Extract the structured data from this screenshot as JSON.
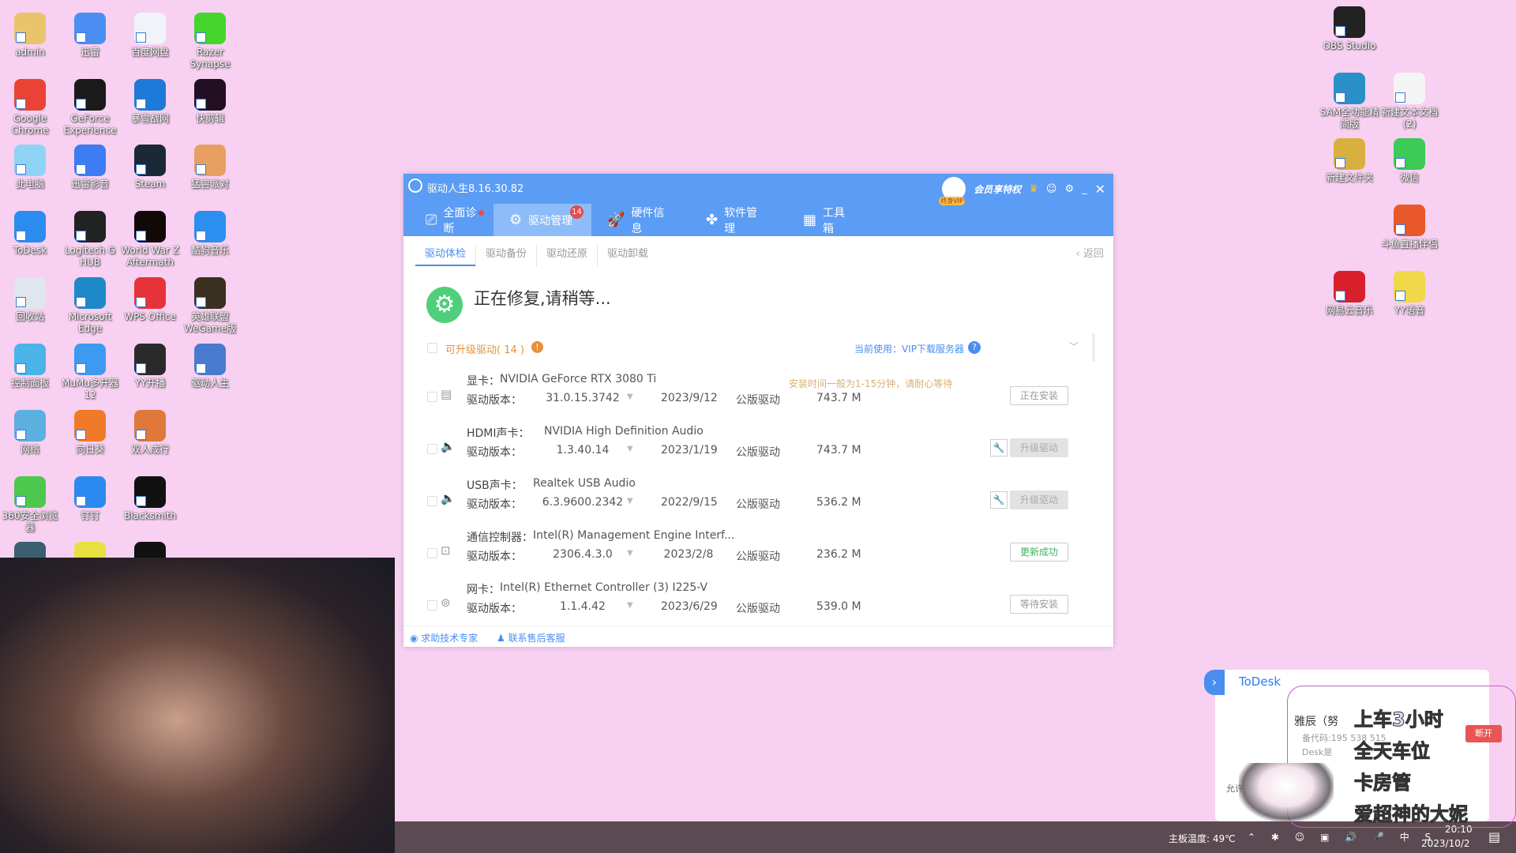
{
  "desktop": {
    "left_icons": [
      {
        "label": "admin",
        "color": "#e9c46a"
      },
      {
        "label": "Google Chrome",
        "color": "#ea4335"
      },
      {
        "label": "此电脑",
        "color": "#8fd3f4"
      },
      {
        "label": "ToDesk",
        "color": "#2b8cf0"
      },
      {
        "label": "回收站",
        "color": "#dfe6ee"
      },
      {
        "label": "控制面板",
        "color": "#4ab3e8"
      },
      {
        "label": "网络",
        "color": "#5bb0e0"
      },
      {
        "label": "360安全浏览器",
        "color": "#4cc94c"
      },
      {
        "label": "",
        "color": "#3a6070"
      },
      {
        "label": "迅雷",
        "color": "#4b8ff2"
      },
      {
        "label": "GeForce Experience",
        "color": "#1a1a1a"
      },
      {
        "label": "迅雷影音",
        "color": "#3d7cf3"
      },
      {
        "label": "Logitech G HUB",
        "color": "#222"
      },
      {
        "label": "Microsoft Edge",
        "color": "#1e88c8"
      },
      {
        "label": "MuMu多开器12",
        "color": "#3d9af0"
      },
      {
        "label": "向日葵",
        "color": "#f07a2a"
      },
      {
        "label": "钉钉",
        "color": "#2a8af0"
      },
      {
        "label": "",
        "color": "#e8e040"
      },
      {
        "label": "百度网盘",
        "color": "#f0f4fa"
      },
      {
        "label": "暴雪战网",
        "color": "#1d7ad8"
      },
      {
        "label": "Steam",
        "color": "#1b2838"
      },
      {
        "label": "World War Z Aftermath",
        "color": "#120808"
      },
      {
        "label": "WPS Office",
        "color": "#e8323a"
      },
      {
        "label": "YY开播",
        "color": "#2a2a2a"
      },
      {
        "label": "双人成行",
        "color": "#e0783a"
      },
      {
        "label": "Blacksmith",
        "color": "#111"
      },
      {
        "label": "",
        "color": "#111"
      },
      {
        "label": "Razer Synapse",
        "color": "#44d62c"
      },
      {
        "label": "快剪辑",
        "color": "#221022"
      },
      {
        "label": "猛兽派对",
        "color": "#e8a060"
      },
      {
        "label": "酷狗音乐",
        "color": "#2b8ff0"
      },
      {
        "label": "英雄联盟WeGame版",
        "color": "#3a3020"
      },
      {
        "label": "驱动人生",
        "color": "#4a7ad0"
      }
    ],
    "right_icons": [
      {
        "label": "OBS Studio",
        "color": "#222"
      },
      {
        "label": "SAM全功能精简版",
        "color": "#2a90c8"
      },
      {
        "label": "新建文本文档 (2)",
        "color": "#f4f4f4"
      },
      {
        "label": "新建文件夹",
        "color": "#d8b040"
      },
      {
        "label": "微信",
        "color": "#3ccb56"
      },
      {
        "label": "斗鱼直播伴侣",
        "color": "#e8582a"
      },
      {
        "label": "网易云音乐",
        "color": "#d8202a"
      },
      {
        "label": "YY语音",
        "color": "#f0d848"
      }
    ]
  },
  "app": {
    "title": "驱动人生8.16.30.82",
    "vip_label": "会员享特权",
    "vip_badge": "终身VIP",
    "tabs": [
      {
        "label": "全面诊断"
      },
      {
        "label": "驱动管理",
        "badge": "14"
      },
      {
        "label": "硬件信息"
      },
      {
        "label": "软件管理"
      },
      {
        "label": "工具箱"
      }
    ],
    "subtabs": [
      "驱动体检",
      "驱动备份",
      "驱动还原",
      "驱动卸载"
    ],
    "back": "返回",
    "status": "正在修复,请稍等...",
    "upgradable": "可升级驱动( 14 )",
    "server": "当前使用：VIP下载服务器",
    "version_label": "驱动版本：",
    "note": "安装时间一般为1-15分钟，请耐心等待",
    "drivers": [
      {
        "type": "显卡：",
        "name": "NVIDIA GeForce RTX 3080 Ti",
        "version": "31.0.15.3742",
        "date": "2023/9/12",
        "kind": "公版驱动",
        "size": "743.7 M",
        "action": "正在安装",
        "icon": "display-card-icon"
      },
      {
        "type": "HDMI声卡：",
        "name": "NVIDIA High Definition Audio",
        "version": "1.3.40.14",
        "date": "2023/1/19",
        "kind": "公版驱动",
        "size": "743.7 M",
        "action": "升级驱动",
        "icon": "speaker-icon"
      },
      {
        "type": "USB声卡：",
        "name": "Realtek USB Audio",
        "version": "6.3.9600.2342",
        "date": "2022/9/15",
        "kind": "公版驱动",
        "size": "536.2 M",
        "action": "升级驱动",
        "icon": "speaker-icon"
      },
      {
        "type": "通信控制器：",
        "name": "Intel(R) Management Engine Interf...",
        "version": "2306.4.3.0",
        "date": "2023/2/8",
        "kind": "公版驱动",
        "size": "236.2 M",
        "action": "更新成功",
        "icon": "chip-icon"
      },
      {
        "type": "网卡：",
        "name": "Intel(R) Ethernet Controller (3) I225-V",
        "version": "1.1.4.42",
        "date": "2023/6/29",
        "kind": "公版驱动",
        "size": "539.0 M",
        "action": "等待安装",
        "icon": "network-card-icon"
      }
    ],
    "footer": {
      "expert": "求助技术专家",
      "service": "联系售后客服"
    },
    "accent": "#5b9cf4"
  },
  "todesk": {
    "title": "ToDesk",
    "name": "雅辰（努",
    "code": "备代码:195 538 515",
    "line3": "Desk是",
    "allow": "允许",
    "disconnect": "断开"
  },
  "overlay": [
    "上车3小时",
    "全天车位",
    "卡房管",
    "爱超神的大妮"
  ],
  "taskbar": {
    "temp": "主板温度: 49℃",
    "time": "20:10",
    "date": "2023/10/2"
  }
}
